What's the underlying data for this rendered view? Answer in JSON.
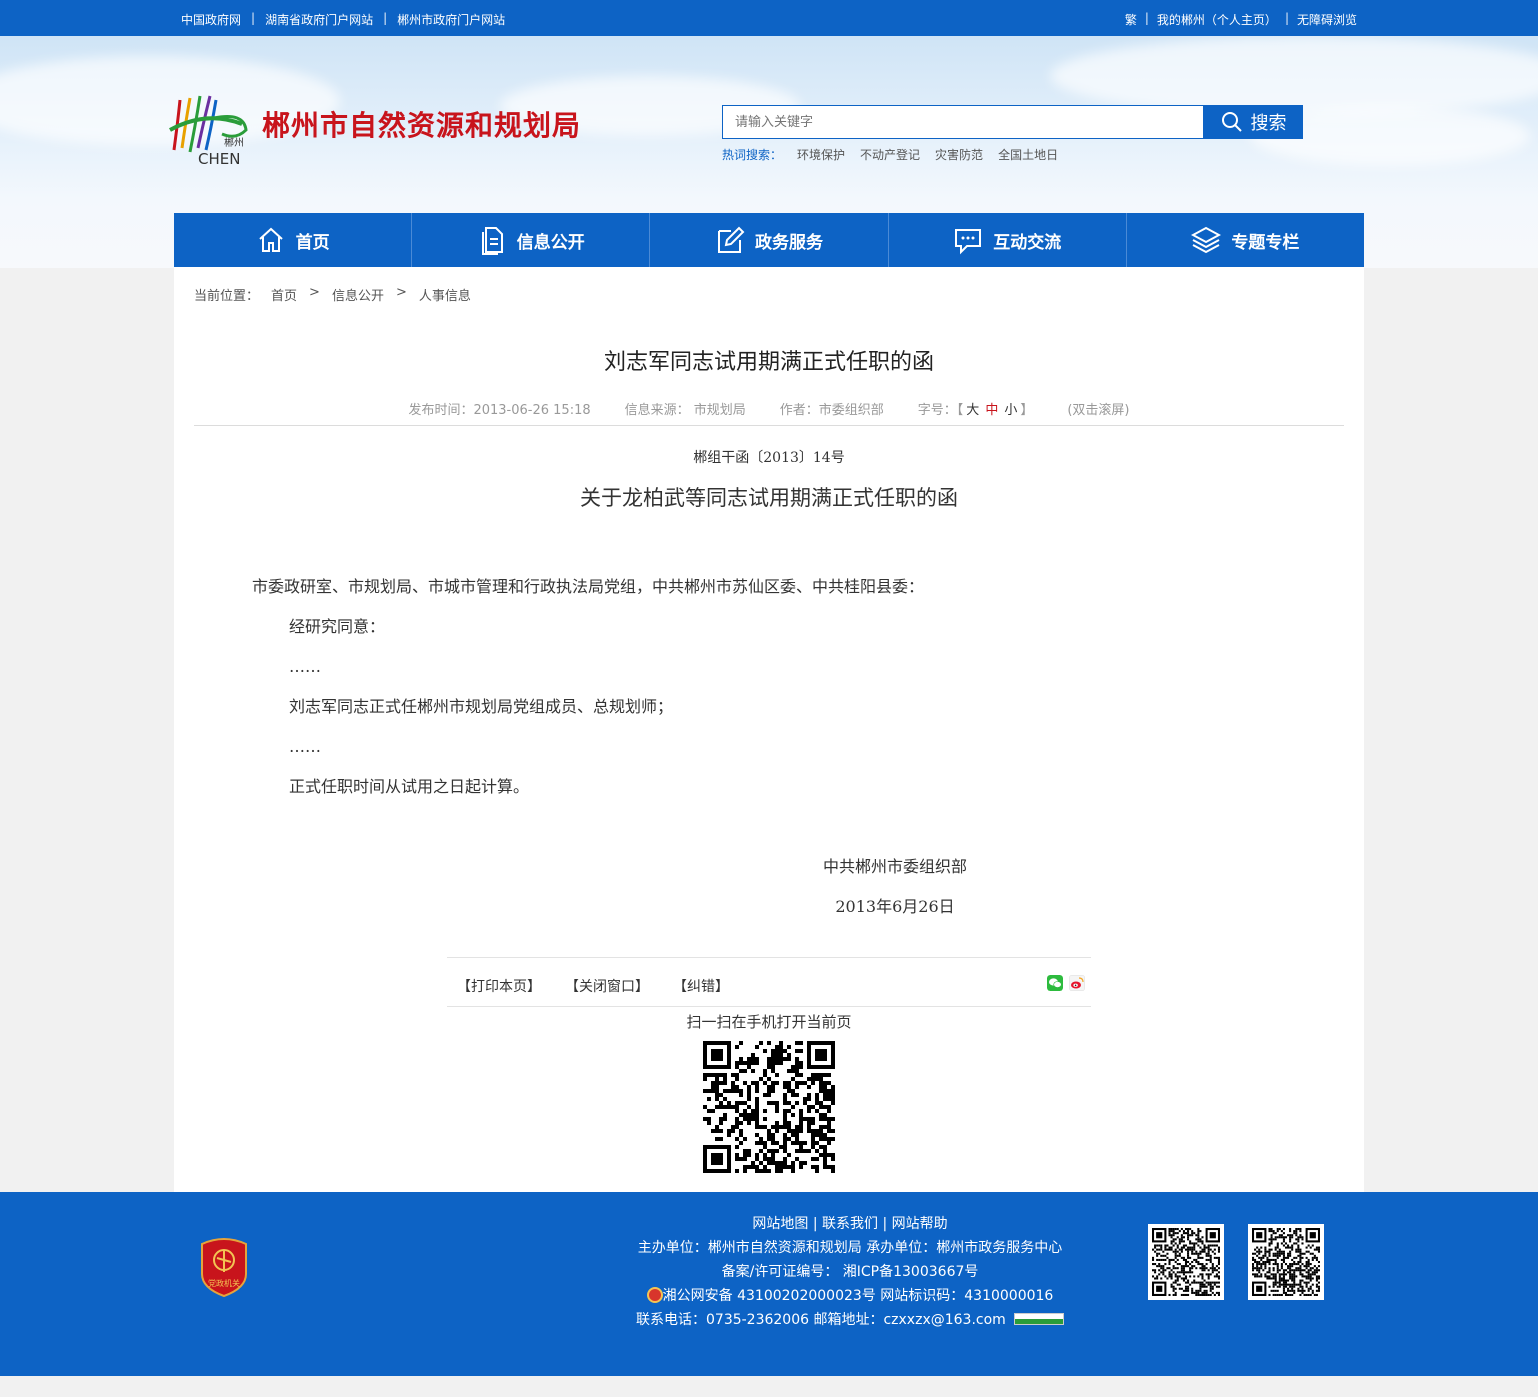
{
  "topbar": {
    "left_links": [
      "中国政府网",
      "湖南省政府门户网站",
      "郴州市政府门户网站"
    ],
    "right_links": [
      "繁",
      "我的郴州（个人主页）",
      "无障碍浏览"
    ],
    "separator": "|"
  },
  "header": {
    "logo_text": "郴州",
    "logo_sub": "CHEN",
    "site_title": "郴州市自然资源和规划局",
    "search_placeholder": "请输入关键字",
    "search_button": "搜索",
    "hot_label": "热词搜索：",
    "hot_words": [
      "环境保护",
      "不动产登记",
      "灾害防范",
      "全国土地日"
    ]
  },
  "nav": [
    {
      "label": "首页",
      "icon": "home-icon"
    },
    {
      "label": "信息公开",
      "icon": "document-icon"
    },
    {
      "label": "政务服务",
      "icon": "edit-icon"
    },
    {
      "label": "互动交流",
      "icon": "chat-icon"
    },
    {
      "label": "专题专栏",
      "icon": "layers-icon"
    }
  ],
  "breadcrumb": {
    "prefix": "当前位置：",
    "items": [
      "首页",
      "信息公开",
      "人事信息"
    ],
    "separator": ">"
  },
  "article": {
    "title": "刘志军同志试用期满正式任职的函",
    "meta": {
      "publish": "发布时间：2013-06-26 15:18",
      "source": "信息来源：  市规划局",
      "author": "作者：市委组织部",
      "font_label": "字号：【",
      "font_big": "大",
      "font_mid": "中",
      "font_small": "小",
      "font_close": "】",
      "scroll": "(双击滚屏)"
    },
    "doc_no": "郴组干函〔2013〕14号",
    "doc_title": "关于龙柏武等同志试用期满正式任职的函",
    "salutation": "市委政研室、市规划局、市城市管理和行政执法局党组，中共郴州市苏仙区委、中共桂阳县委：",
    "paragraphs": [
      "经研究同意：",
      "……",
      "刘志军同志正式任郴州市规划局党组成员、总规划师；",
      "……",
      "正式任职时间从试用之日起计算。"
    ],
    "signature": "中共郴州市委组织部",
    "date": "2013年6月26日"
  },
  "tools": {
    "print": "【打印本页】",
    "close": "【关闭窗口】",
    "correct": "【纠错】",
    "qr_caption": "扫一扫在手机打开当前页"
  },
  "footer": {
    "links": "网站地图 | 联系我们 | 网站帮助",
    "host": "主办单位：郴州市自然资源和规划局    承办单位：郴州市政务服务中心",
    "icp": "备案/许可证编号：  湘ICP备13003667号",
    "police": "湘公网安备 43100202000023号    网站标识码：4310000016",
    "contact": "联系电话：0735-2362006    邮箱地址：czxxzx@163.com",
    "emblem_text": "党政机关"
  },
  "colors": {
    "primary": "#0d63c5",
    "title_red": "#c8141c"
  }
}
